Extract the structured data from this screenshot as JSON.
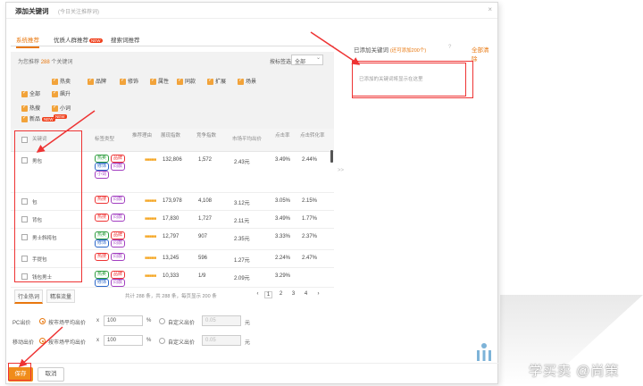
{
  "dialog": {
    "title": "添加关键词",
    "subtitle": "(今日关注推荐词)",
    "close": "×"
  },
  "tabs": [
    {
      "label": "系统推荐",
      "active": true
    },
    {
      "label": "优质人群推荐",
      "badge": "NEW"
    },
    {
      "label": "搜索词推荐"
    }
  ],
  "filter": {
    "count_prefix": "为您推荐",
    "count_value": "288",
    "count_suffix": "个关键词",
    "sort_label": "按标签选",
    "sort_value": "全部",
    "checkboxes": [
      {
        "label": "热卖"
      },
      {
        "label": "品牌"
      },
      {
        "label": "修饰"
      },
      {
        "label": "属性"
      },
      {
        "label": "同款"
      },
      {
        "label": "扩展"
      },
      {
        "label": "场景"
      },
      {
        "label": "全部"
      },
      {
        "label": "飙升"
      },
      {
        "label": "热搜"
      },
      {
        "label": "新品",
        "badge": "NEW"
      },
      {
        "label": "小词",
        "badge": "NEW"
      }
    ]
  },
  "table": {
    "headers": [
      "关键词",
      "标签类型",
      "推荐理由",
      "展现指数",
      "竞争指数",
      "市场平均出价",
      "点击率",
      "点击转化率"
    ],
    "rows": [
      {
        "name": "男包",
        "tags": [
          [
            "g",
            "热卖"
          ],
          [
            "r",
            "品牌"
          ],
          [
            "b",
            "修饰"
          ],
          [
            "p",
            "同款"
          ],
          [
            "p",
            "小词"
          ]
        ],
        "stars": "■■■■■",
        "c1": "132,806",
        "c2": "1,572",
        "c3": "2.43元",
        "c4": "3.49%",
        "c5": "2.44%"
      },
      {
        "name": "包",
        "tags": [
          [
            "r",
            "热搜"
          ],
          [
            "p",
            "同款"
          ]
        ],
        "stars": "■■■■■",
        "c1": "173,978",
        "c2": "4,108",
        "c3": "3.12元",
        "c4": "3.05%",
        "c5": "2.15%"
      },
      {
        "name": "背包",
        "tags": [
          [
            "r",
            "热搜"
          ],
          [
            "p",
            "同款"
          ]
        ],
        "stars": "■■■■■",
        "c1": "17,830",
        "c2": "1,727",
        "c3": "2.11元",
        "c4": "3.49%",
        "c5": "1.77%"
      },
      {
        "name": "男士斜挎包",
        "tags": [
          [
            "g",
            "热卖"
          ],
          [
            "r",
            "品牌"
          ],
          [
            "b",
            "修饰"
          ],
          [
            "p",
            "同款"
          ]
        ],
        "stars": "■■■■■",
        "c1": "12,797",
        "c2": "907",
        "c3": "2.35元",
        "c4": "3.33%",
        "c5": "2.37%"
      },
      {
        "name": "手提包",
        "tags": [
          [
            "r",
            "热搜"
          ],
          [
            "p",
            "同款"
          ]
        ],
        "stars": "■■■■■",
        "c1": "13,245",
        "c2": "596",
        "c3": "1.27元",
        "c4": "2.24%",
        "c5": "2.47%"
      },
      {
        "name": "钱包男士",
        "tags": [
          [
            "g",
            "热卖"
          ],
          [
            "r",
            "品牌"
          ],
          [
            "b",
            "修饰"
          ],
          [
            "p",
            "同款"
          ]
        ],
        "stars": "■■■■■",
        "c1": "10,333",
        "c2": "1/9",
        "c3": "2.09元",
        "c4": "3.29%",
        "c5": ""
      }
    ]
  },
  "pager": {
    "tab1": "行业热词",
    "tab2": "精准流量",
    "info": "共计 288 条，共 288 条，每页显示 200 条",
    "pages": [
      "1",
      "2",
      "3",
      "4"
    ],
    "prev": "‹",
    "next": "›",
    "mid_arrow": ">>"
  },
  "right": {
    "title": "已添加关键词",
    "hint": "(还可添加200个)",
    "help": "?",
    "clear": "全部清除",
    "placeholder": "已添加的关键词将显示在这里"
  },
  "bid_row": {
    "label": "PC出价",
    "opt1": "按市场平均出价",
    "times": "x",
    "val1": "100",
    "pct": "%",
    "opt2": "自定义出价",
    "val2": "0.05",
    "unit": "元"
  },
  "mobile_row": {
    "label": "移动出价",
    "opt1": "按市场平均出价",
    "times": "x",
    "val1": "100",
    "pct": "%",
    "opt2": "自定义出价",
    "val2": "0.05",
    "unit": "元"
  },
  "footer": {
    "save": "保存",
    "cancel": "取消"
  },
  "watermark": "学买卖 @尚策",
  "colors": {
    "accent": "#e8770e",
    "annotation": "#e33333"
  }
}
